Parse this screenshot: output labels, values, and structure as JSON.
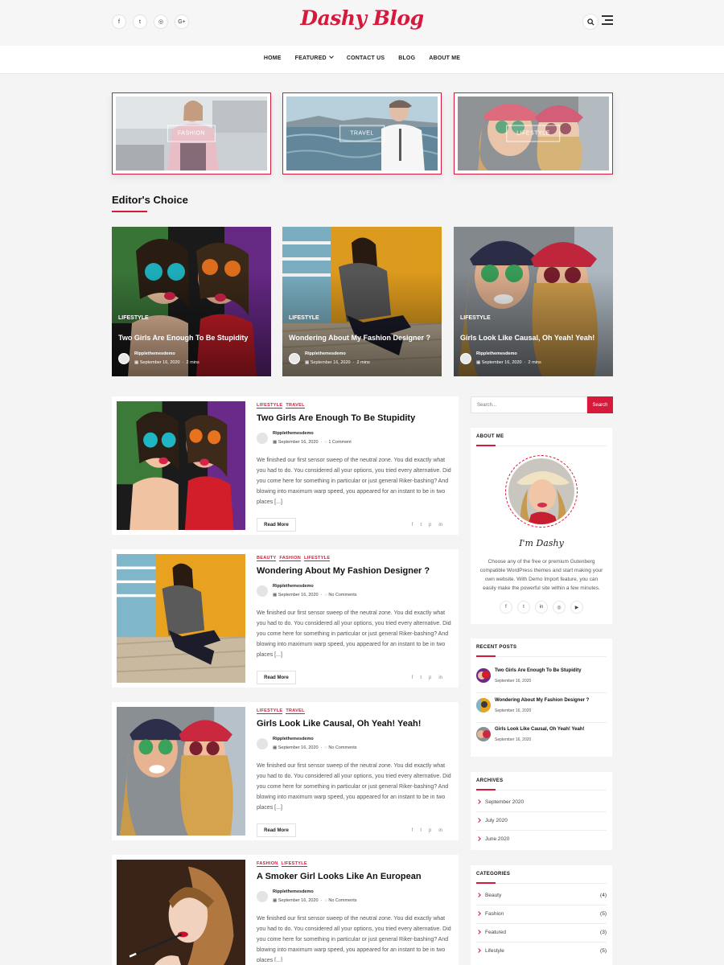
{
  "header": {
    "logo": "Dashy Blog",
    "social": [
      {
        "icon": "facebook-icon",
        "glyph": "f"
      },
      {
        "icon": "twitter-icon",
        "glyph": "t"
      },
      {
        "icon": "instagram-icon",
        "glyph": "◎"
      },
      {
        "icon": "google-plus-icon",
        "glyph": "G+"
      }
    ]
  },
  "nav": {
    "items": [
      {
        "label": "HOME",
        "dropdown": false
      },
      {
        "label": "FEATURED",
        "dropdown": true
      },
      {
        "label": "CONTACT US",
        "dropdown": false
      },
      {
        "label": "BLOG",
        "dropdown": false
      },
      {
        "label": "ABOUT ME",
        "dropdown": false
      }
    ]
  },
  "category_cards": [
    {
      "label": "FASHION",
      "image": "fashion"
    },
    {
      "label": "TRAVEL",
      "image": "travel"
    },
    {
      "label": "LIFESTYLE",
      "image": "lifestyle"
    }
  ],
  "editors_choice": {
    "title": "Editor's Choice",
    "cards": [
      {
        "category": "LIFESTYLE",
        "title": "Two Girls Are Enough To Be Stupidity",
        "author": "Ripplethemesdemo",
        "date": "September 16, 2020",
        "read": "2 mins",
        "image": "selfie"
      },
      {
        "category": "LIFESTYLE",
        "title": "Wondering About My Fashion Designer ?",
        "author": "Ripplethemesdemo",
        "date": "September 16, 2020",
        "read": "2 mins",
        "image": "designer"
      },
      {
        "category": "LIFESTYLE",
        "title": "Girls Look Like Causal, Oh Yeah! Yeah!",
        "author": "Ripplethemesdemo",
        "date": "September 16, 2020",
        "read": "2 mins",
        "image": "hats"
      }
    ]
  },
  "posts": [
    {
      "categories": [
        "LIFESTYLE",
        "TRAVEL"
      ],
      "title": "Two Girls Are Enough To Be Stupidity",
      "author": "Ripplethemesdemo",
      "date": "September 16, 2020",
      "comments": "1 Comment",
      "excerpt": "We finished our first sensor sweep of the neutral zone. You did exactly what you had to do. You considered all your options, you tried every alternative. Did you come here for something in particular or just general Riker-bashing? And blowing into maximum warp speed, you appeared for an instant to be in two places [...]",
      "read_more": "Read More",
      "image": "selfie"
    },
    {
      "categories": [
        "BEAUTY",
        "FASHION",
        "LIFESTYLE"
      ],
      "title": "Wondering About My Fashion Designer ?",
      "author": "Ripplethemesdemo",
      "date": "September 16, 2020",
      "comments": "No Comments",
      "excerpt": "We finished our first sensor sweep of the neutral zone. You did exactly what you had to do. You considered all your options, you tried every alternative. Did you come here for something in particular or just general Riker-bashing? And blowing into maximum warp speed, you appeared for an instant to be in two places [...]",
      "read_more": "Read More",
      "image": "designer"
    },
    {
      "categories": [
        "LIFESTYLE",
        "TRAVEL"
      ],
      "title": "Girls Look Like Causal, Oh Yeah! Yeah!",
      "author": "Ripplethemesdemo",
      "date": "September 16, 2020",
      "comments": "No Comments",
      "excerpt": "We finished our first sensor sweep of the neutral zone. You did exactly what you had to do. You considered all your options, you tried every alternative. Did you come here for something in particular or just general Riker-bashing? And blowing into maximum warp speed, you appeared for an instant to be in two places [...]",
      "read_more": "Read More",
      "image": "hats"
    },
    {
      "categories": [
        "FASHION",
        "LIFESTYLE"
      ],
      "title": "A Smoker Girl Looks Like An European",
      "author": "Ripplethemesdemo",
      "date": "September 16, 2020",
      "comments": "No Comments",
      "excerpt": "We finished our first sensor sweep of the neutral zone. You did exactly what you had to do. You considered all your options, you tried every alternative. Did you come here for something in particular or just general Riker-bashing? And blowing into maximum warp speed, you appeared for an instant to be in two places [...]",
      "read_more": "Read More",
      "image": "smoker"
    }
  ],
  "sidebar": {
    "search": {
      "placeholder": "Search...",
      "button": "Search"
    },
    "about": {
      "title": "ABOUT ME",
      "signature": "I'm Dashy",
      "text": "Choose any of the free or premium Gutenberg compatible WordPress themes and start making your own website. With Demo Import feature, you can easily make the powerful site within a few minutes.",
      "social": [
        {
          "icon": "facebook-icon",
          "glyph": "f"
        },
        {
          "icon": "twitter-icon",
          "glyph": "t"
        },
        {
          "icon": "linkedin-icon",
          "glyph": "in"
        },
        {
          "icon": "instagram-icon",
          "glyph": "◎"
        },
        {
          "icon": "youtube-icon",
          "glyph": "▶"
        }
      ]
    },
    "recent_posts": {
      "title": "RECENT POSTS",
      "items": [
        {
          "title": "Two Girls Are Enough To Be Stupidity",
          "date": "September 16, 2020",
          "image": "selfie"
        },
        {
          "title": "Wondering About My Fashion Designer ?",
          "date": "September 16, 2020",
          "image": "designer"
        },
        {
          "title": "Girls Look Like Causal, Oh Yeah! Yeah!",
          "date": "September 16, 2020",
          "image": "hats"
        }
      ]
    },
    "archives": {
      "title": "ARCHIVES",
      "items": [
        "September 2020",
        "July 2020",
        "June 2020"
      ]
    },
    "categories": {
      "title": "CATEGORIES",
      "items": [
        {
          "label": "Beauty",
          "count": "(4)"
        },
        {
          "label": "Fashion",
          "count": "(5)"
        },
        {
          "label": "Featured",
          "count": "(3)"
        },
        {
          "label": "Lifestyle",
          "count": "(5)"
        }
      ]
    }
  },
  "colors": {
    "accent": "#d7193c",
    "background": "#f4f4f5"
  }
}
